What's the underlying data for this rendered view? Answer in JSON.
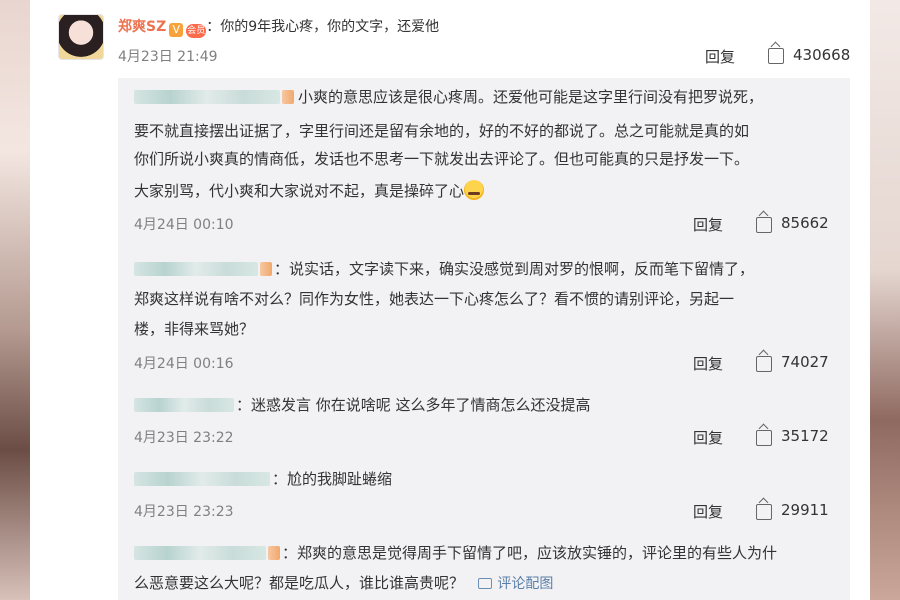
{
  "main_comment": {
    "username": "郑爽SZ",
    "verified_badge": "V",
    "vip_badge": "会员",
    "text": "：你的9年我心疼，你的文字，还爱他",
    "time": "4月23日 21:49",
    "reply_label": "回复",
    "likes": "430668"
  },
  "replies": [
    {
      "lines": [
        "小爽的意思应该是很心疼周。还爱他可能是这字里行间没有把罗说死，",
        "要不就直接摆出证据了，字里行间还是留有余地的，好的不好的都说了。总之可能就是真的如",
        "你们所说小爽真的情商低，发话也不思考一下就发出去评论了。但也可能真的只是抒发一下。",
        "大家别骂，代小爽和大家说对不起，真是操碎了心"
      ],
      "time": "4月24日 00:10",
      "reply_label": "回复",
      "likes": "85662"
    },
    {
      "lines": [
        "：说实话，文字读下来，确实没感觉到周对罗的恨啊，反而笔下留情了，",
        "郑爽这样说有啥不对么？同作为女性，她表达一下心疼怎么了？看不惯的请别评论，另起一",
        "楼，非得来骂她？"
      ],
      "time": "4月24日 00:16",
      "reply_label": "回复",
      "likes": "74027"
    },
    {
      "lines": [
        "：迷惑发言 你在说啥呢 这么多年了情商怎么还没提高"
      ],
      "time": "4月23日 23:22",
      "reply_label": "回复",
      "likes": "35172"
    },
    {
      "lines": [
        "：尬的我脚趾蜷缩"
      ],
      "time": "4月23日 23:23",
      "reply_label": "回复",
      "likes": "29911"
    },
    {
      "lines": [
        "：郑爽的意思是觉得周手下留情了吧，应该放实锤的，评论里的有些人为什",
        "么恶意要这么大呢？都是吃瓜人，谁比谁高贵呢？"
      ],
      "image_link": "评论配图"
    }
  ]
}
